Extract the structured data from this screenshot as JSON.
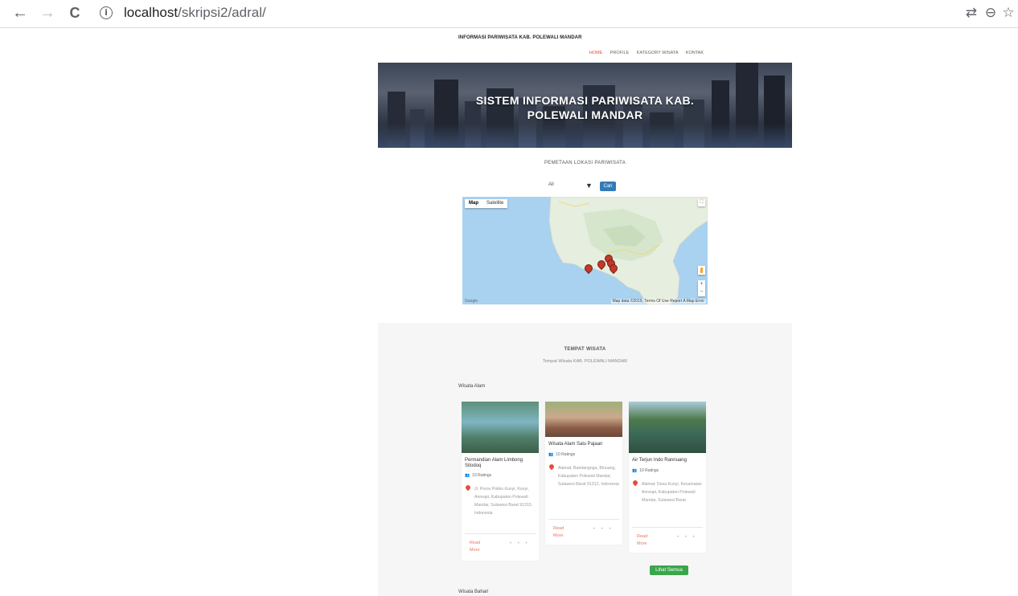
{
  "browser": {
    "url_host": "localhost",
    "url_path": "/skripsi2/adral/",
    "back_glyph": "←",
    "forward_glyph": "→",
    "reload_glyph": "C",
    "info_glyph": "i",
    "translate_glyph": "⇄",
    "zoom_glyph": "⊖",
    "star_glyph": "☆"
  },
  "site": {
    "title": "INFORMASI PARIWISATA KAB. POLEWALI MANDAR",
    "menu": [
      "HOME",
      "PROFILE",
      "KATEGORY WISATA",
      "KONTAK"
    ],
    "hero_line1": "SISTEM INFORMASI PARIWISATA KAB.",
    "hero_line2": "POLEWALI MANDAR"
  },
  "map_section": {
    "title": "PEMETAAN LOKASI PARIWISATA",
    "filter_value": "All",
    "filter_arrow": "▼",
    "search_button": "Cari",
    "map_type_map": "Map",
    "map_type_satellite": "Satellite",
    "zoom_in": "+",
    "zoom_out": "−",
    "footer": "Map data ©2019, Terms Of Use  Report A Map Error",
    "logo": "Google"
  },
  "tempat_wisata": {
    "title": "TEMPAT WISATA",
    "subtitle": "Tempat Wisata KAB. POLEWALI MANDAR",
    "category1": "Wisata Alam",
    "category2": "Wisata Bahari",
    "rating_icon": "user-group-icon",
    "cards": [
      {
        "title": "Permandian Alam Limbong Sitodoq",
        "rating": "10 Ratings",
        "address": "Jl. Poros Pokko Kunyi, Kunyi, Anreapi, Kabupaten Polewali Mandar, Sulawesi Barat 91315, Indonesia",
        "more": "Read More",
        "dots": "• • •"
      },
      {
        "title": "Wisata Alam Salu Pajaan",
        "rating": "10 Ratings",
        "address": "Alamat, Batetangnga, Binuang, Kabupaten Polewali Mandar, Sulawesi Barat 91312, Indonesia",
        "more": "Read More",
        "dots": "• • •"
      },
      {
        "title": "Air Terjun Indo Rannuang",
        "rating": "10 Ratings",
        "address": "Alamat: Desa Kunyi, Kecamatan Anreapi, Kabupaten Polewali Mandar, Sulawesi Barat",
        "more": "Read More",
        "dots": "• • •"
      }
    ],
    "see_all": "Lihat Semua"
  }
}
